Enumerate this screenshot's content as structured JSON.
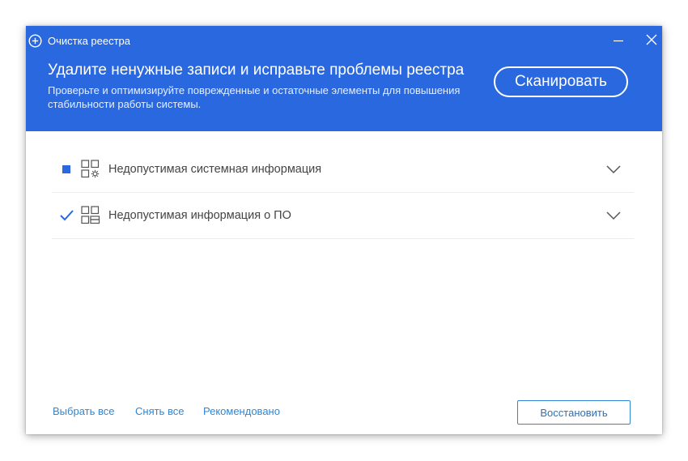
{
  "window": {
    "title": "Очистка реестра",
    "app_icon": "plus-circle-icon"
  },
  "header": {
    "headline": "Удалите ненужные записи и исправьте проблемы реестра",
    "description": "Проверьте и оптимизируйте поврежденные и остаточные элементы для повышения стабильности работы системы.",
    "scan_label": "Сканировать"
  },
  "categories": [
    {
      "label": "Недопустимая системная информация",
      "check_state": "partial",
      "icon": "system-grid-gear-icon"
    },
    {
      "label": "Недопустимая информация о ПО",
      "check_state": "checked",
      "icon": "software-grid-icon"
    }
  ],
  "footer": {
    "select_all": "Выбрать все",
    "deselect_all": "Снять все",
    "recommended": "Рекомендовано",
    "restore_label": "Восстановить"
  },
  "colors": {
    "header_bg": "#2a68e0",
    "accent": "#2f86d6",
    "text": "#444444"
  }
}
